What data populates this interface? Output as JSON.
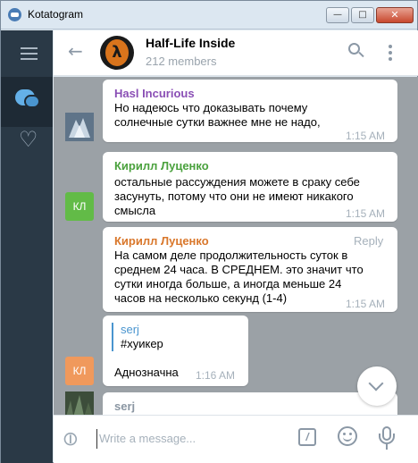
{
  "window": {
    "title": "Kotatogram",
    "minimize_label": "—",
    "maximize_label": "□",
    "close_label": "✕"
  },
  "header": {
    "group_name": "Half-Life Inside",
    "members": "212 members",
    "avatar_glyph": "λ"
  },
  "messages": [
    {
      "author": "Hasl Incurious",
      "author_color": "#8a4fb5",
      "lines": [
        "Но надеюсь что доказывать почему",
        "солнечные сутки важнее мне не надо,"
      ],
      "time": "1:15 AM"
    },
    {
      "author": "Кирилл Луценко",
      "author_color": "#4aa13d",
      "avatar_initials": "КЛ",
      "avatar_color": "#62bb47",
      "lines": [
        "остальные рассуждения можете в сраку себе",
        "засунуть, потому что они не имеют никакого",
        "смысла"
      ],
      "time": "1:15 AM"
    },
    {
      "author": "Кирилл Луценко",
      "author_color": "#d9772b",
      "reply_label": "Reply",
      "lines": [
        "На самом деле продолжительность суток в",
        "среднем 24 часа. В СРЕДНЕМ. это значит что",
        "сутки иногда больше, а иногда меньше 24",
        "часов на несколько секунд (1-4)"
      ],
      "time": "1:15 AM"
    },
    {
      "quote_name": "serj",
      "quote_text": "#хуикер",
      "avatar_initials": "КЛ",
      "avatar_color": "#f0995c",
      "text": "Аднозначна",
      "time": "1:16 AM"
    },
    {
      "author": "serj",
      "author_color": "#8a96a2"
    }
  ],
  "compose": {
    "placeholder": "Write a message...",
    "command_label": "/"
  },
  "icons": {
    "menu": "hamburger-icon",
    "chats": "chat-bubbles-icon",
    "favorites": "heart-icon",
    "back": "arrow-left-icon",
    "search": "search-icon",
    "more": "more-vertical-icon",
    "scroll": "chevron-down-icon",
    "attach": "paperclip-icon",
    "emoji": "emoji-icon",
    "mic": "microphone-icon"
  }
}
